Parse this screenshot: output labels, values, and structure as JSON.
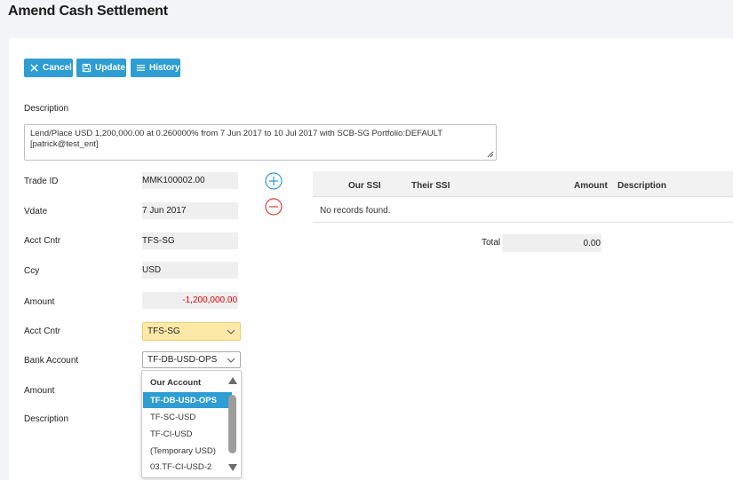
{
  "page": {
    "title": "Amend Cash Settlement"
  },
  "toolbar": {
    "cancel_label": "Cancel",
    "update_label": "Update",
    "history_label": "History"
  },
  "description": {
    "label": "Description",
    "value": "Lend/Place USD 1,200,000.00 at 0.260000% from 7 Jun 2017 to 10 Jul 2017 with SCB-SG  Portfolio:DEFAULT [patrick@test_ent]"
  },
  "form": {
    "trade_id": {
      "label": "Trade ID",
      "value": "MMK100002.00"
    },
    "vdate": {
      "label": "Vdate",
      "value": "7 Jun 2017"
    },
    "acct_cntr_ro": {
      "label": "Acct Cntr",
      "value": "TFS-SG"
    },
    "ccy": {
      "label": "Ccy",
      "value": "USD"
    },
    "amount_ro": {
      "label": "Amount",
      "value": "-1,200,000.00"
    },
    "acct_cntr_sel": {
      "label": "Acct Cntr",
      "value": "TFS-SG"
    },
    "bank_account": {
      "label": "Bank Account",
      "value": "TF-DB-USD-OPS"
    },
    "amount": {
      "label": "Amount"
    },
    "description2": {
      "label": "Description"
    }
  },
  "grid": {
    "columns": [
      "Our SSI",
      "Their SSI",
      "Amount",
      "Description"
    ],
    "empty_text": "No records found.",
    "total_label": "Total",
    "total_value": "0.00"
  },
  "dropdown": {
    "group_label": "Our Account",
    "options": [
      "TF-DB-USD-OPS",
      "TF-SC-USD",
      "TF-CI-USD",
      "(Temporary USD)",
      "03.TF-CI-USD-2"
    ],
    "selected_index": 0
  },
  "colors": {
    "accent": "#2e9dd3",
    "negative": "#e00000",
    "add_icon": "#2e9dd3",
    "remove_icon": "#e03c31",
    "highlight_select": "#fde9a7"
  },
  "icons": {
    "cancel": "close-icon",
    "update": "save-icon",
    "history": "menu-icon",
    "add": "plus-circle-icon",
    "remove": "minus-circle-icon"
  }
}
